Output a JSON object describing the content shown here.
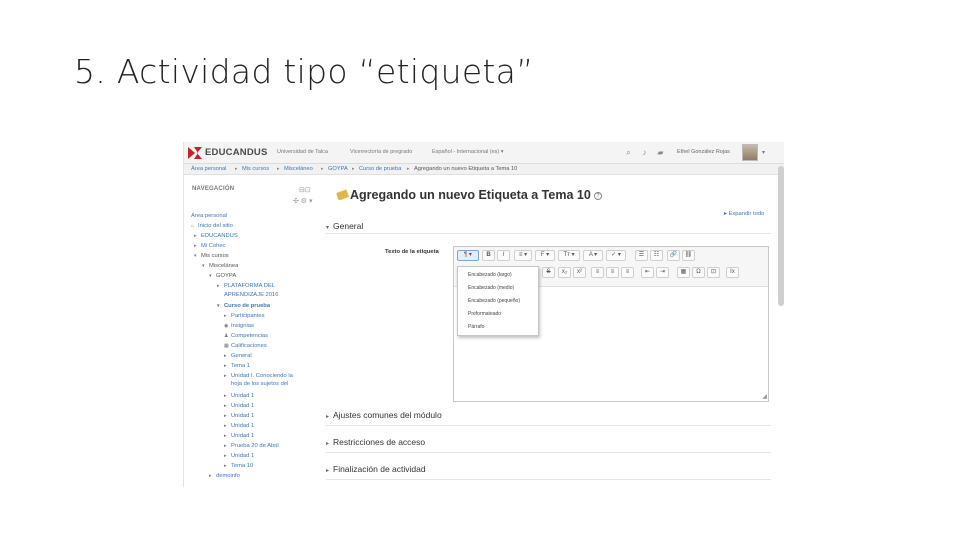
{
  "slide": {
    "title": "5. Actividad tipo “etiqueta”"
  },
  "navbar": {
    "brand": "EDUCANDUS",
    "links": [
      "Universidad de Talca",
      "Vicerrectoría de pregrado",
      "Español - Internacional (es) ▾"
    ],
    "icons": [
      "search-icon",
      "bell-icon",
      "chat-icon"
    ],
    "user": "Ethel González Rojas"
  },
  "breadcrumb": [
    "Área personal",
    "Mis cursos",
    "Misceláneo",
    "GOYPA",
    "Curso de prueba",
    "Agregando un nuevo Etiqueta a Tema 10"
  ],
  "sidebar": {
    "header": "NAVEGACIÓN",
    "items": [
      "Área personal",
      "Inicio del sitio",
      "EDUCANDUS",
      "Mi Cohec",
      "Mis cursos",
      "Miscelánea",
      "GOYPA",
      "PLATAFORMA DEL",
      "APRENDIZAJE 2016",
      "Curso de prueba",
      "Participantes",
      "Insignias",
      "Competencias",
      "Calificaciones",
      "General",
      "Tema 1",
      "Unidad I. Conociendo la",
      "hoja de los sujetos del",
      "Unidad 1",
      "Unidad 1",
      "Unidad 1",
      "Unidad 1",
      "Unidad 1",
      "Prueba 20 de Abril",
      "Unidad 1",
      "Tema 10",
      "demoinfo"
    ]
  },
  "main": {
    "title": "Agregando un nuevo Etiqueta a Tema 10",
    "expand_all": "▸ Expandir todo",
    "sections": {
      "general": "General",
      "module_settings": "Ajustes comunes del módulo",
      "restrictions": "Restricciones de acceso",
      "completion": "Finalización de actividad"
    },
    "field_label": "Texto de la etiqueta",
    "toolbar": {
      "row1": [
        "¶ ▾",
        "B",
        "I",
        "≡ ▾",
        "F ▾",
        "Tт ▾",
        "A ▾",
        "✓ ▾",
        "☰",
        "☷",
        "🔗",
        "⛓"
      ],
      "row2": [
        "S",
        "x₂",
        "x²",
        "≡",
        "≡",
        "≡",
        "⇤",
        "⇥",
        "▦",
        "Ω",
        "⊡",
        "Ix"
      ]
    },
    "dropdown": [
      "Encabezado (largo)",
      "Encabezado (medio)",
      "Encabezado (pequeño)",
      "Preformateado",
      "Párrafo"
    ]
  }
}
